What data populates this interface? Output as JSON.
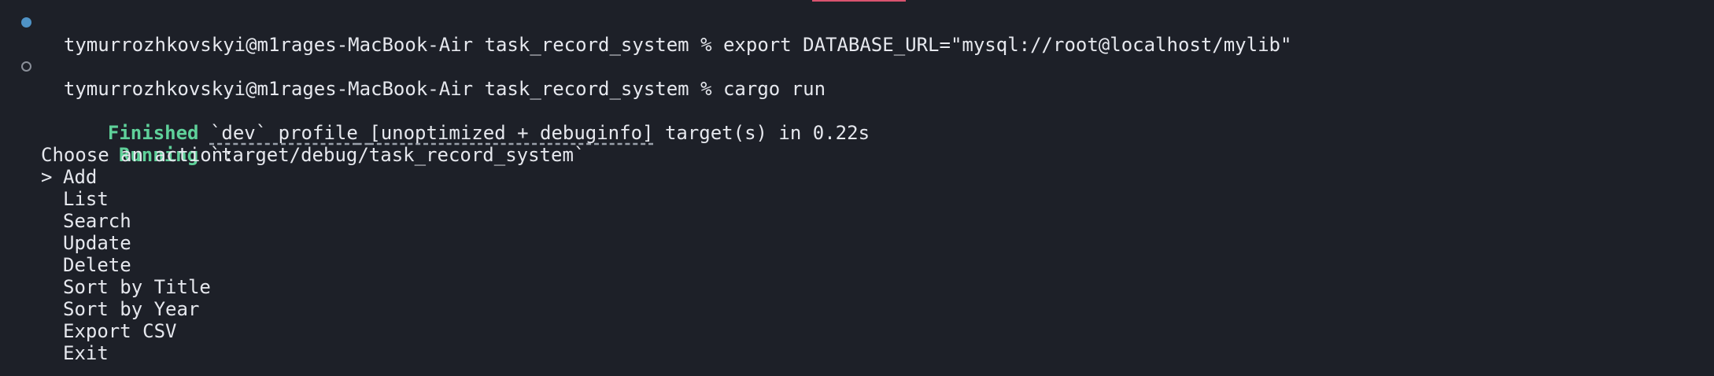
{
  "commands": [
    {
      "prompt": "tymurrozhkovskyi@m1rages-MacBook-Air task_record_system %",
      "command": "export DATABASE_URL=\"mysql://root@localhost/mylib\"",
      "status": "completed"
    },
    {
      "prompt": "tymurrozhkovskyi@m1rages-MacBook-Air task_record_system %",
      "command": "cargo run",
      "status": "running"
    }
  ],
  "build_output": {
    "finished_label": "Finished",
    "finished_text_pre": "`dev` profile",
    "finished_text_bracket": "[unoptimized + debuginfo]",
    "finished_text_post": "target(s) in 0.22s",
    "running_label": "Running",
    "running_text": "`target/debug/task_record_system`"
  },
  "menu": {
    "heading": "Choose an action:",
    "cursor": ">",
    "selected_index": 0,
    "items": [
      "Add",
      "List",
      "Search",
      "Update",
      "Delete",
      "Sort by Title",
      "Sort by Year",
      "Export CSV",
      "Exit"
    ]
  },
  "colors": {
    "background": "#1d2028",
    "text": "#e6e8ee",
    "status_green": "#5fd19a",
    "marker_blue": "#4f93c6",
    "tab_accent": "#d9536f"
  }
}
